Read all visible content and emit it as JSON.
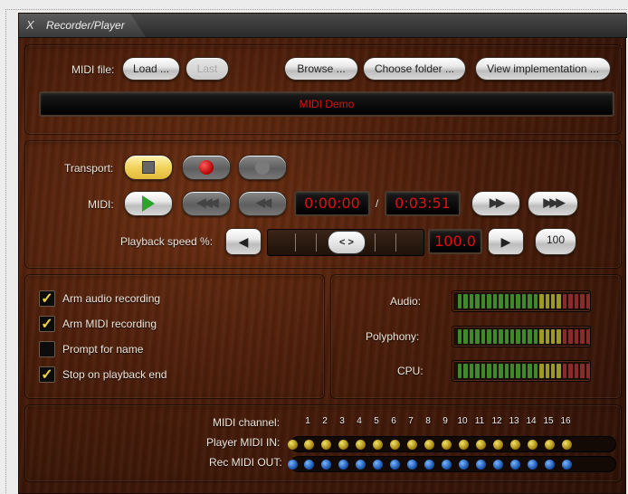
{
  "window": {
    "close_glyph": "X",
    "title": "Recorder/Player"
  },
  "file": {
    "label": "MIDI file:",
    "load": "Load ...",
    "last": "Last",
    "browse": "Browse ...",
    "choose_folder": "Choose folder ...",
    "view_impl": "View implementation ...",
    "current": "MIDI Demo"
  },
  "transport": {
    "label": "Transport:",
    "midi_label": "MIDI:",
    "position": "0:00:00",
    "separator": "/",
    "length": "0:03:51",
    "speed_label": "Playback speed %:",
    "speed_value": "100.0",
    "reset_label": "100",
    "slider_glyph": "< >"
  },
  "options": [
    {
      "label": "Arm audio recording",
      "checked": true
    },
    {
      "label": "Arm MIDI recording",
      "checked": true
    },
    {
      "label": "Prompt for name",
      "checked": false
    },
    {
      "label": "Stop on playback end",
      "checked": true
    }
  ],
  "meters": {
    "audio": "Audio:",
    "polyphony": "Polyphony:",
    "cpu": "CPU:"
  },
  "channels": {
    "label": "MIDI channel:",
    "numbers": [
      "1",
      "2",
      "3",
      "4",
      "5",
      "6",
      "7",
      "8",
      "9",
      "10",
      "11",
      "12",
      "13",
      "14",
      "15",
      "16"
    ],
    "in_label": "Player MIDI IN:",
    "out_label": "Rec MIDI OUT:"
  },
  "colors": {
    "display_text": "#e01010",
    "check": "#f2d24a",
    "led_in": "#c9b21e",
    "led_out": "#2d6fd0"
  }
}
